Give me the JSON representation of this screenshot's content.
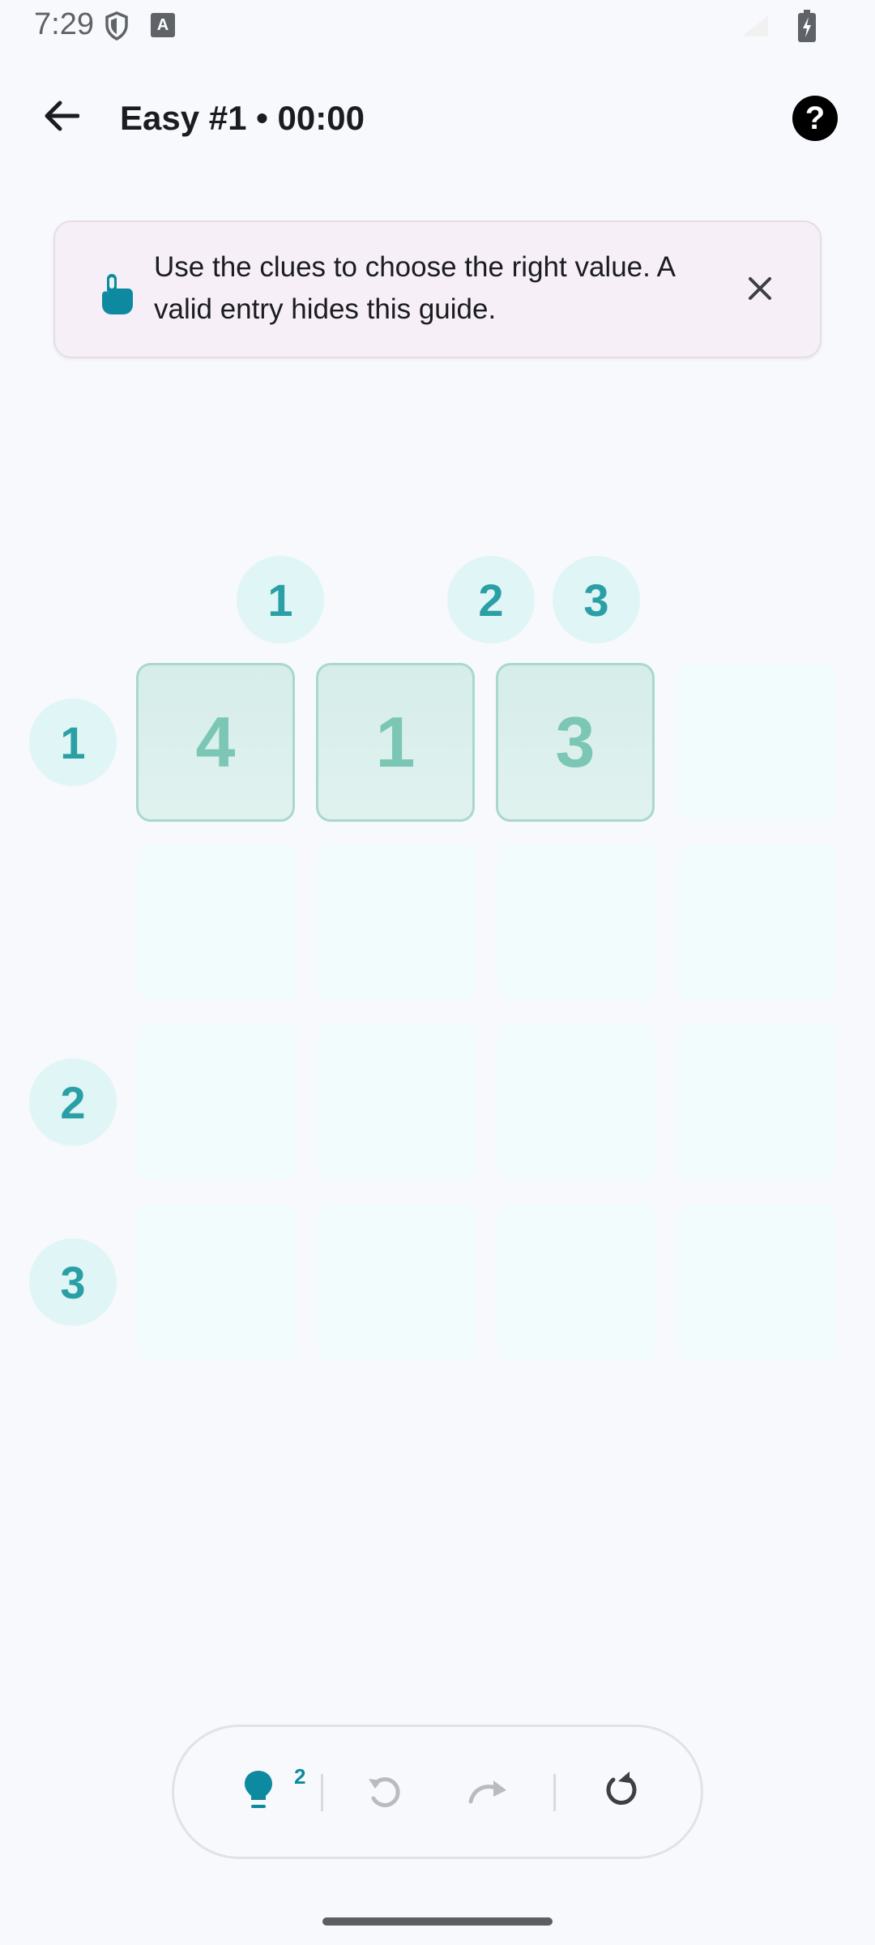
{
  "status_bar": {
    "time": "7:29",
    "icons": [
      "shield-icon",
      "keyboard-a-icon",
      "signal-icon",
      "battery-charging-icon"
    ]
  },
  "top_bar": {
    "title": "Easy #1 • 00:00",
    "back_icon": "arrow-left-icon",
    "help_label": "?"
  },
  "guide": {
    "icon": "tap-hand-icon",
    "text": "Use the clues to choose the right value. A valid entry hides this guide.",
    "close_icon": "close-icon"
  },
  "puzzle": {
    "column_clues": [
      "1",
      "2",
      "3"
    ],
    "row_clues": [
      "1",
      "2",
      "3"
    ],
    "rows": [
      [
        "4",
        "1",
        "3",
        ""
      ],
      [
        "",
        "",
        "",
        ""
      ],
      [
        "",
        "",
        "",
        ""
      ],
      [
        "",
        "",
        "",
        ""
      ]
    ]
  },
  "toolbar": {
    "hint_count": "2",
    "icons": [
      "lightbulb-icon",
      "undo-icon",
      "redo-icon",
      "restart-icon"
    ]
  },
  "colors": {
    "accent": "#2a9fa5",
    "clue_bg": "#e0f5f5",
    "filled_cell": "#d6ede9",
    "empty_cell": "#f3fcfc",
    "guide_bg": "#f6eff7"
  }
}
